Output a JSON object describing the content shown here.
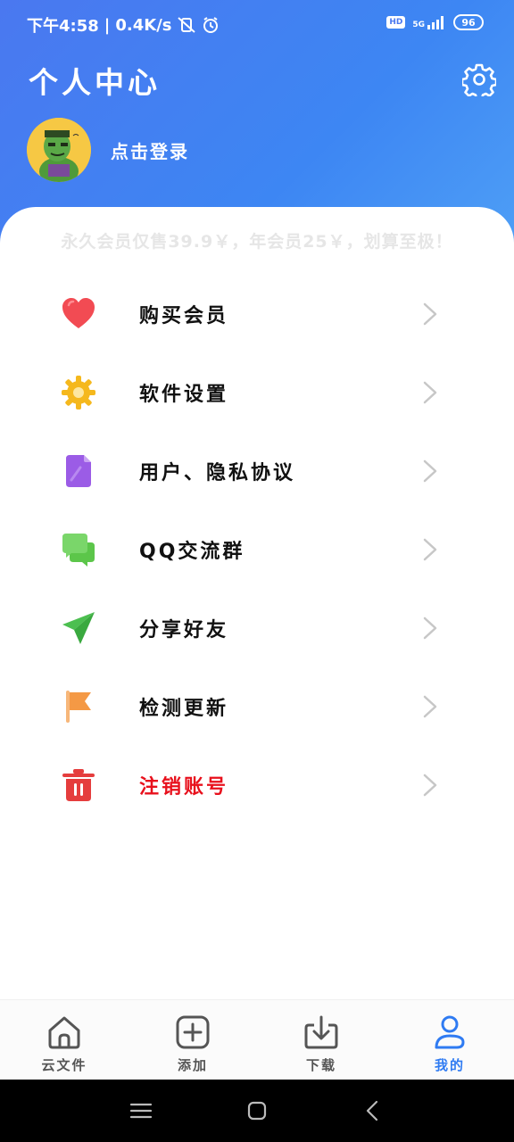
{
  "status_bar": {
    "time": "下午4:58",
    "net_speed": "0.4K/s",
    "hd": "HD",
    "network": "5G",
    "battery": "96"
  },
  "header": {
    "title": "个人中心",
    "login_text": "点击登录"
  },
  "promo_text": "永久会员仅售39.9￥，年会员25￥，划算至极！",
  "menu": [
    {
      "label": "购买会员",
      "icon": "heart-icon",
      "color": "#f24b53"
    },
    {
      "label": "软件设置",
      "icon": "gear-icon",
      "color": "#f5b81d"
    },
    {
      "label": "用户、隐私协议",
      "icon": "document-icon",
      "color": "#9b5ce6"
    },
    {
      "label": "QQ交流群",
      "icon": "chat-icon",
      "color": "#5cc64a"
    },
    {
      "label": "分享好友",
      "icon": "send-icon",
      "color": "#4cbf50"
    },
    {
      "label": "检测更新",
      "icon": "flag-icon",
      "color": "#f49945"
    },
    {
      "label": "注销账号",
      "icon": "trash-icon",
      "color": "#e53d3d",
      "danger": true
    }
  ],
  "bottom_nav": [
    {
      "label": "云文件",
      "icon": "home-icon",
      "active": false
    },
    {
      "label": "添加",
      "icon": "add-icon",
      "active": false
    },
    {
      "label": "下载",
      "icon": "download-icon",
      "active": false
    },
    {
      "label": "我的",
      "icon": "user-icon",
      "active": true
    }
  ],
  "colors": {
    "header_start": "#4a78f0",
    "header_end": "#4fa0f6",
    "active_nav": "#2f7bf2",
    "danger": "#e8101c"
  }
}
